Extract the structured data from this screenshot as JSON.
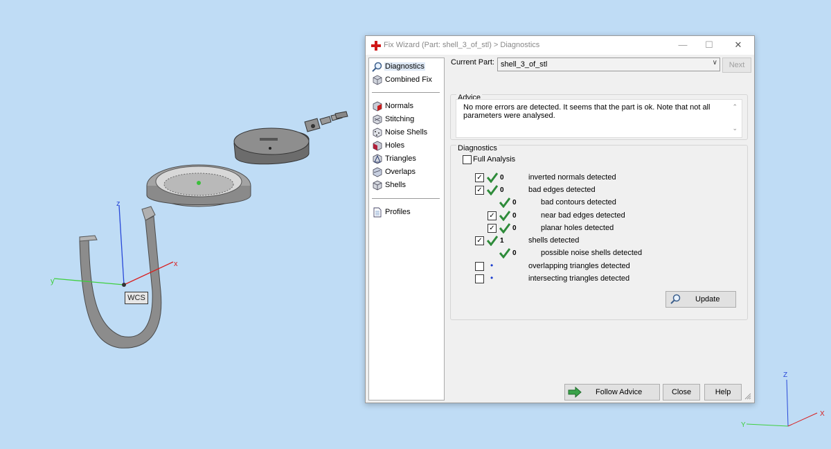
{
  "viewport": {
    "wcs_label": "WCS",
    "axes_main": {
      "x": "x",
      "y": "y",
      "z": "z"
    },
    "axes_corner": {
      "x": "X",
      "y": "Y",
      "z": "Z"
    }
  },
  "dialog": {
    "title": "Fix Wizard (Part: shell_3_of_stl) > Diagnostics",
    "title_icon": "red-cross-icon",
    "window_buttons": {
      "minimize": "—",
      "maximize": "☐",
      "close": "✕"
    },
    "sidebar": {
      "top_items": [
        {
          "label": "Diagnostics",
          "icon": "magnifier-icon",
          "selected": true
        },
        {
          "label": "Combined Fix",
          "icon": "cube-icon"
        }
      ],
      "fix_items": [
        {
          "label": "Normals",
          "icon": "normals-cube-icon"
        },
        {
          "label": "Stitching",
          "icon": "stitching-cube-icon"
        },
        {
          "label": "Noise Shells",
          "icon": "noise-shells-icon"
        },
        {
          "label": "Holes",
          "icon": "holes-cube-icon"
        },
        {
          "label": "Triangles",
          "icon": "triangles-icon"
        },
        {
          "label": "Overlaps",
          "icon": "overlaps-icon"
        },
        {
          "label": "Shells",
          "icon": "shells-icon"
        }
      ],
      "bottom_items": [
        {
          "label": "Profiles",
          "icon": "document-icon"
        }
      ]
    },
    "current_part_label": "Current Part:",
    "current_part_value": "shell_3_of_stl",
    "next_button": "Next",
    "advice": {
      "title": "Advice",
      "text": "No more errors are detected. It seems that the part is ok. Note that not all parameters were analysed."
    },
    "diagnostics": {
      "title": "Diagnostics",
      "full_analysis_label": "Full Analysis",
      "full_analysis_checked": false,
      "rows": [
        {
          "checked": true,
          "status": "ok",
          "count": "0",
          "label": "inverted normals detected"
        },
        {
          "checked": true,
          "status": "ok",
          "count": "0",
          "label": "bad edges detected"
        },
        {
          "checked": null,
          "status": "ok",
          "count": "0",
          "label": "bad contours detected"
        },
        {
          "checked": true,
          "status": "ok",
          "count": "0",
          "label": "near bad edges detected"
        },
        {
          "checked": true,
          "status": "ok",
          "count": "0",
          "label": "planar holes detected"
        },
        {
          "checked": true,
          "status": "ok",
          "count": "1",
          "label": "shells detected"
        },
        {
          "checked": null,
          "status": "ok",
          "count": "0",
          "label": "possible noise shells detected"
        },
        {
          "checked": false,
          "status": "unknown",
          "count": "",
          "label": "overlapping triangles detected"
        },
        {
          "checked": false,
          "status": "unknown",
          "count": "",
          "label": "intersecting triangles detected"
        }
      ],
      "update_button": "Update"
    },
    "buttons": {
      "follow_advice": "Follow Advice",
      "close": "Close",
      "help": "Help"
    },
    "colors": {
      "ok_tick": "#2e8b3a",
      "accent_red": "#d01818",
      "dot_blue": "#1a3ccf"
    }
  }
}
